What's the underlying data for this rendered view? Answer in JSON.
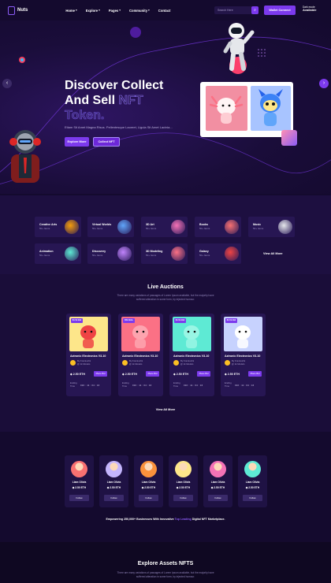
{
  "header": {
    "logo_text": "Nuts",
    "nav": [
      {
        "label": "Home",
        "caret": true
      },
      {
        "label": "Explore",
        "caret": true
      },
      {
        "label": "Pages",
        "caret": true
      },
      {
        "label": "Community",
        "caret": true
      },
      {
        "label": "Contact",
        "caret": false
      }
    ],
    "search_placeholder": "Search Here",
    "wallet_label": "Wallet Connect",
    "dark_mode_label": "Dark mode",
    "dark_mode_value": "Available"
  },
  "hero": {
    "title_line1": "Discover Collect",
    "title_line2_a": "And Sell ",
    "title_line2_b": "NFT",
    "title_line3": "Token.",
    "subtitle": "Etiam Sit Amet Magna Risus. Pellentesque Laoreet, Ligula Sit Amet Lacinia...",
    "explore_label": "Explore More",
    "collect_label": "Collect NFT"
  },
  "categories": [
    {
      "name": "Creative Arts",
      "count": "50+ Items",
      "color": "#f59e0b"
    },
    {
      "name": "Virtual Worlds",
      "count": "50+ Items",
      "color": "#60a5fa"
    },
    {
      "name": "3D Art",
      "count": "50+ Items",
      "color": "#f472b6"
    },
    {
      "name": "Books",
      "count": "50+ Items",
      "color": "#f87171"
    },
    {
      "name": "Music",
      "count": "50+ Items",
      "color": "#e5e7eb"
    },
    {
      "name": "Animation",
      "count": "50+ Items",
      "color": "#5eead4"
    },
    {
      "name": "Discovery",
      "count": "50+ Items",
      "color": "#c084fc"
    },
    {
      "name": "3D Modeling",
      "count": "50+ Items",
      "color": "#fb7185"
    },
    {
      "name": "Galaxy",
      "count": "50+ Items",
      "color": "#ef4444"
    }
  ],
  "categories_view_all": "View All More",
  "live": {
    "title": "Live Auctions",
    "subtitle_line1": "There are many variations of passages of Lorem Ipsum available, but the majority have",
    "subtitle_line2": "suffered alteration in some form, by injected humour.",
    "items": [
      {
        "badge": "$1.5k Bid",
        "name": "Aztronic Electronics V3-10",
        "creator": "By Frankoshk",
        "handle": "@ 1k Models",
        "price": "2.50 ETH",
        "place_bid": "Place Bid",
        "ending": "Ending Time",
        "time": "010 : 11 : 04 : 16",
        "color": "#ef4444"
      },
      {
        "badge": "$5k Bids",
        "name": "Aztronic Electronics V3-10",
        "creator": "By Frankoshk",
        "handle": "@ 1k Models",
        "price": "2.50 ETH",
        "place_bid": "Place Bid",
        "ending": "Ending Time",
        "time": "010 : 11 : 04 : 16",
        "color": "#fda4af"
      },
      {
        "badge": "$1.5k Bid",
        "name": "Aztronic Electronics V3-10",
        "creator": "By Frankoshk",
        "handle": "@ 1k Models",
        "price": "2.50 ETH",
        "place_bid": "Place Bid",
        "ending": "Ending Time",
        "time": "010 : 11 : 04 : 16",
        "color": "#99f6e4"
      },
      {
        "badge": "$1.5k Bid",
        "name": "Aztronic Electronics V3-10",
        "creator": "By Frankoshk",
        "handle": "@ 1k Models",
        "price": "2.50 ETH",
        "place_bid": "Place Bid",
        "ending": "Ending Time",
        "time": "010 : 11 : 04 : 16",
        "color": "#ffffff"
      }
    ],
    "view_all": "View All More"
  },
  "sellers": [
    {
      "name": "Liam Olivia",
      "price": "2.50 ETH",
      "follow": "Follow",
      "color": "#f87171"
    },
    {
      "name": "Liam Olivia",
      "price": "2.50 ETH",
      "follow": "Follow",
      "color": "#c4b5fd"
    },
    {
      "name": "Liam Olivia",
      "price": "2.50 ETH",
      "follow": "Follow",
      "color": "#fb923c"
    },
    {
      "name": "Liam Olivia",
      "price": "2.50 ETH",
      "follow": "Follow",
      "color": "#fde68a"
    },
    {
      "name": "Liam Olivia",
      "price": "2.50 ETH",
      "follow": "Follow",
      "color": "#f472b6"
    },
    {
      "name": "Liam Olivia",
      "price": "2.50 ETH",
      "follow": "Follow",
      "color": "#5eead4"
    }
  ],
  "empower": {
    "before": "Empowering 250,000+ Businesses With Innovative ",
    "highlight": "Top Leading",
    "after": " Digital NFT Marketplace."
  },
  "explore": {
    "title": "Explore Assets NFTS",
    "subtitle_line1": "There are many variations of passages of Lorem Ipsum available, but the majority have",
    "subtitle_line2": "suffered alteration in some form, by injected humour."
  }
}
